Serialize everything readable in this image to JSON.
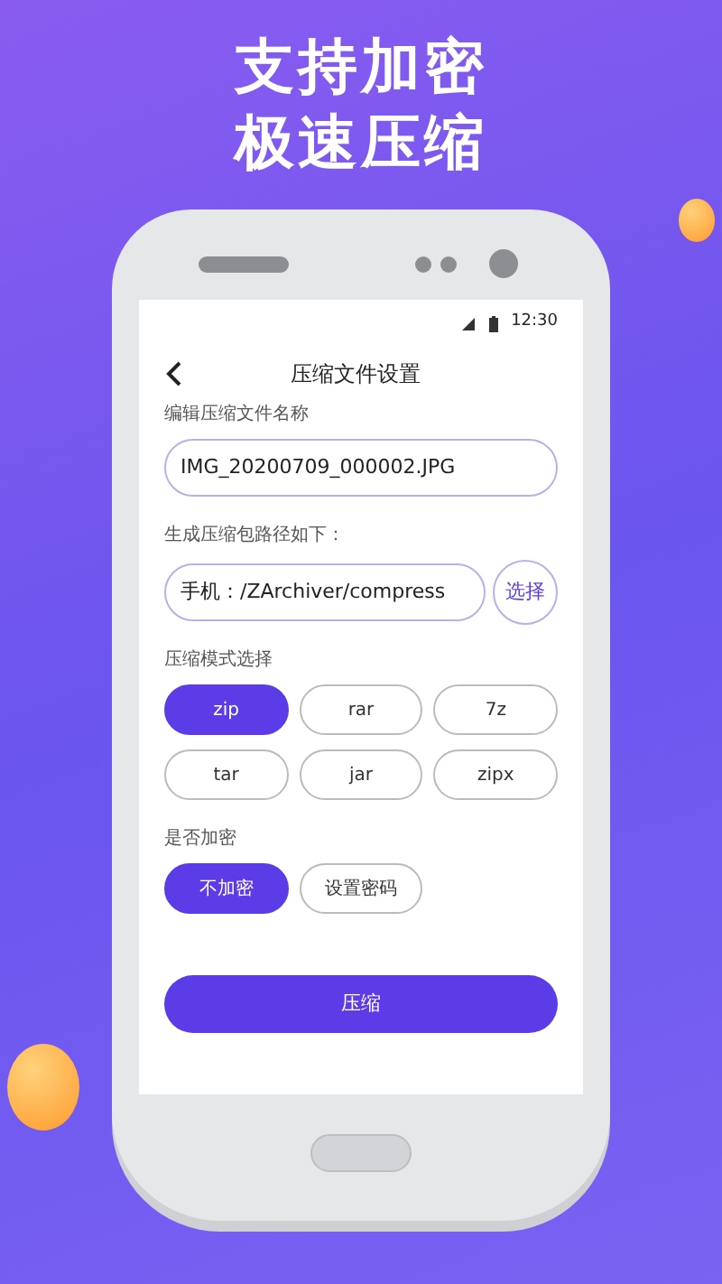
{
  "headline": [
    "支持加密",
    "极速压缩"
  ],
  "status_bar": {
    "time": "12:30"
  },
  "header": {
    "title": "压缩文件设置"
  },
  "file_name": {
    "label": "编辑压缩文件名称",
    "value": "IMG_20200709_000002.JPG"
  },
  "output_path": {
    "label": "生成压缩包路径如下：",
    "value": "手机：/ZArchiver/compress",
    "button": "选择"
  },
  "format": {
    "label": "压缩模式选择",
    "options": [
      {
        "label": "zip",
        "selected": true
      },
      {
        "label": "rar",
        "selected": false
      },
      {
        "label": "7z",
        "selected": false
      },
      {
        "label": "tar",
        "selected": false
      },
      {
        "label": "jar",
        "selected": false
      },
      {
        "label": "zipx",
        "selected": false
      }
    ]
  },
  "encryption": {
    "label": "是否加密",
    "options": [
      {
        "label": "不加密",
        "selected": true
      },
      {
        "label": "设置密码",
        "selected": false
      }
    ]
  },
  "submit_button": "压缩"
}
